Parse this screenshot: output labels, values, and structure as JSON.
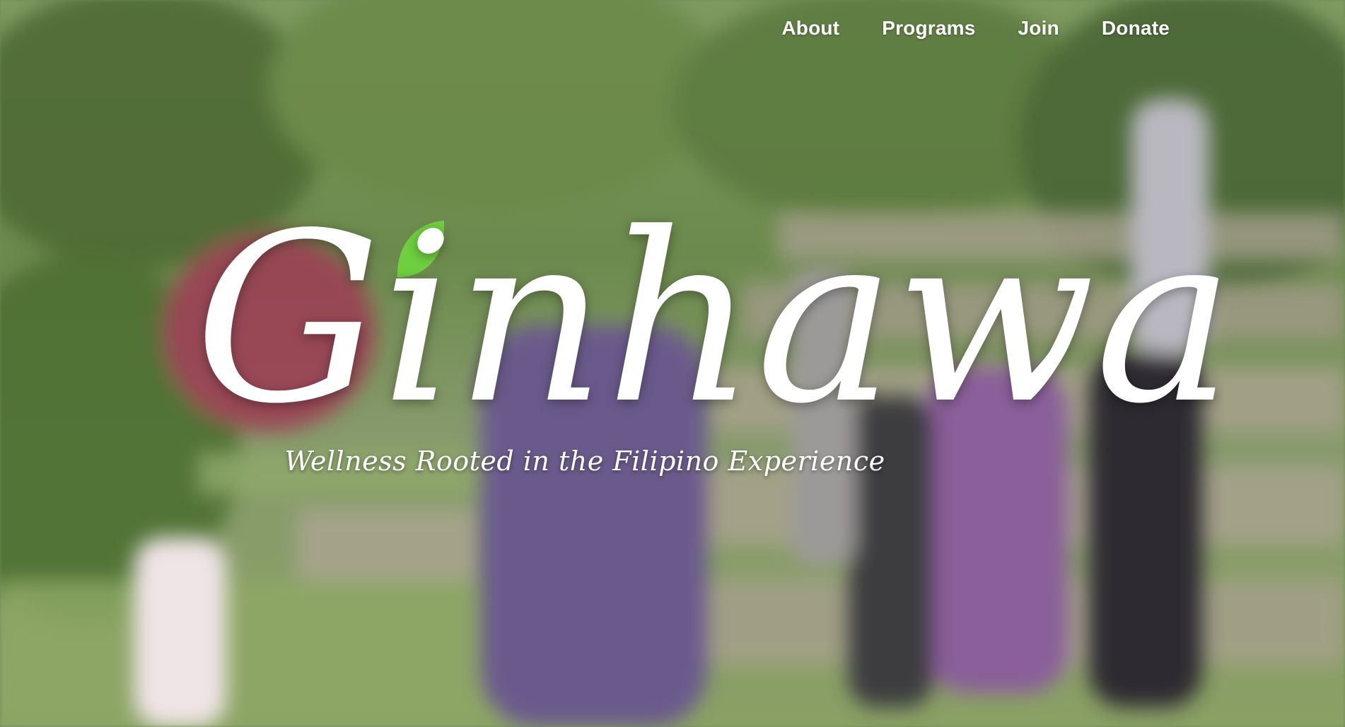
{
  "nav": {
    "items": [
      {
        "label": "About"
      },
      {
        "label": "Programs"
      },
      {
        "label": "Join"
      },
      {
        "label": "Donate"
      }
    ]
  },
  "hero": {
    "title": "Ginhawa",
    "tagline": "Wellness Rooted in the Filipino Experience",
    "leaf_color": "#6fcf3f",
    "background_description_colors": {
      "foliage": "#5f7a45",
      "grass": "#8fa86a",
      "stone": "#a9a48e"
    }
  }
}
